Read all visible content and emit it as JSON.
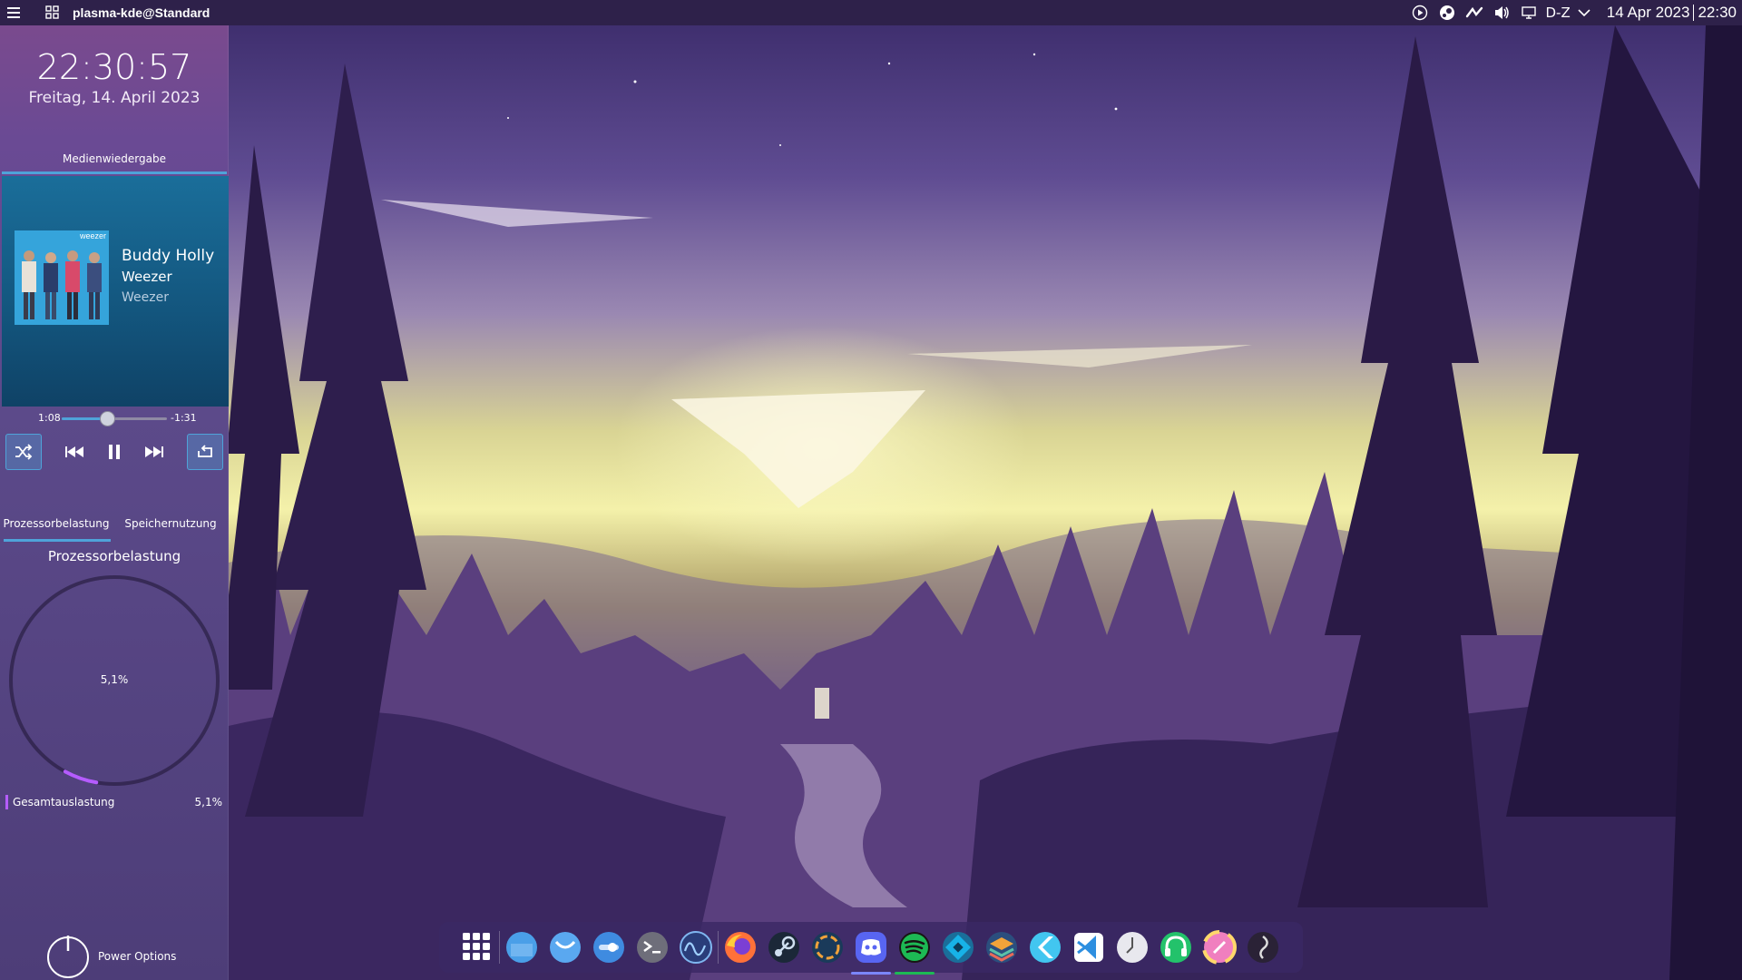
{
  "top_panel": {
    "window_title": "plasma-kde@Standard",
    "keyboard_layout": "D-Z",
    "date": "14 Apr 2023",
    "time": "22:30",
    "menu_icon": "hamburger-menu-icon",
    "grid_icon": "app-grid-icon",
    "tray_icons": [
      "media-play-icon",
      "steam-tray-icon",
      "kde-connect-icon",
      "volume-icon",
      "display-icon",
      "chevron-down-icon"
    ]
  },
  "sidebar": {
    "clock_time": "22:30:57",
    "clock_date": "Freitag, 14. April 2023",
    "media": {
      "header": "Medienwiedergabe",
      "album_band_label": "weezer",
      "title": "Buddy Holly",
      "artist": "Weezer",
      "album": "Weezer",
      "elapsed": "1:08",
      "remaining": "-1:31",
      "progress": 0.43,
      "controls": [
        "shuffle-icon",
        "previous-icon",
        "pause-icon",
        "next-icon",
        "repeat-icon"
      ]
    },
    "monitor": {
      "tab_cpu": "Prozessorbelastung",
      "tab_memory": "Speichernutzung",
      "title": "Prozessorbelastung",
      "value": "5,1%",
      "value_fraction": 0.051,
      "legend_label": "Gesamtauslastung",
      "legend_value": "5,1%",
      "accent": "#b55cff"
    },
    "power_label": "Power Options"
  },
  "dock": {
    "items": [
      {
        "name": "app-launcher-icon",
        "color": "#ffffff"
      },
      {
        "name": "file-manager-icon",
        "color": "#4a9fe8"
      },
      {
        "name": "discover-store-icon",
        "color": "#5aa8f0"
      },
      {
        "name": "system-settings-icon",
        "color": "#3f8be0"
      },
      {
        "name": "terminal-icon",
        "color": "#6e6e7a"
      },
      {
        "name": "system-monitor-icon",
        "color": "#2a3d7a"
      },
      {
        "name": "firefox-icon",
        "color": "#ff7139"
      },
      {
        "name": "steam-icon",
        "color": "#1b2838"
      },
      {
        "name": "lutris-icon",
        "color": "#1a3a5a"
      },
      {
        "name": "discord-icon",
        "color": "#5865f2",
        "indicator": "#7b86ff"
      },
      {
        "name": "spotify-icon",
        "color": "#1db954",
        "indicator": "#1db954"
      },
      {
        "name": "kodi-icon",
        "color": "#17b2e7"
      },
      {
        "name": "stacer-icon",
        "color": "#f2a33a"
      },
      {
        "name": "flutter-icon",
        "color": "#42c6f0"
      },
      {
        "name": "vscode-icon",
        "color": "#2d8fe0"
      },
      {
        "name": "clock-icon",
        "color": "#e8e8ee"
      },
      {
        "name": "headset-icon",
        "color": "#23c26b"
      },
      {
        "name": "color-picker-icon",
        "color": "#f07fbf"
      },
      {
        "name": "obs-studio-icon",
        "color": "#2a2236"
      }
    ]
  }
}
